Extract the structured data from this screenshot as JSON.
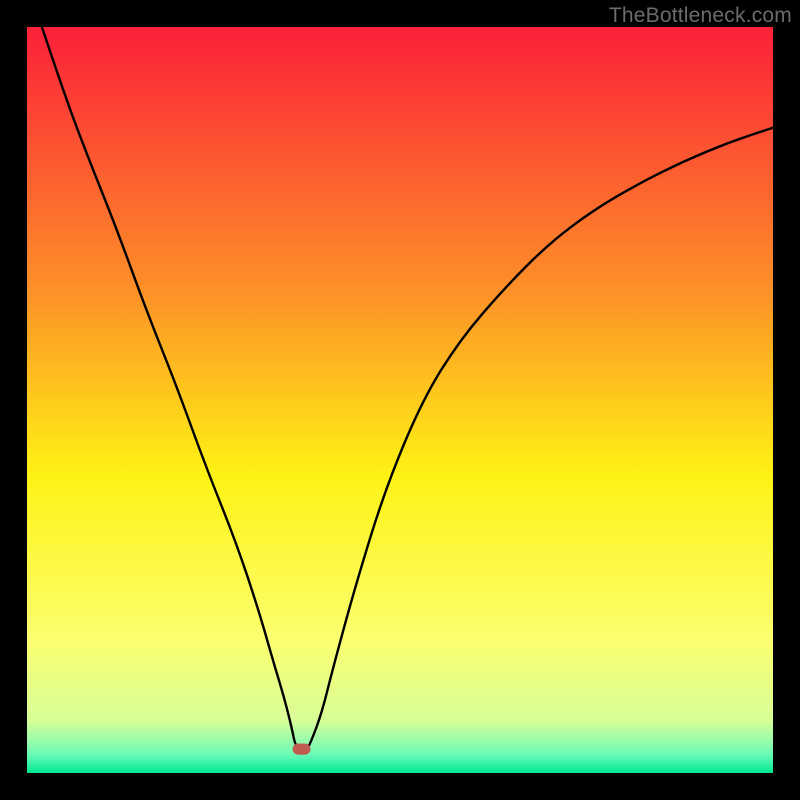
{
  "watermark": "TheBottleneck.com",
  "chart_data": {
    "type": "line",
    "title": "",
    "xlabel": "",
    "ylabel": "",
    "xlim": [
      0,
      100
    ],
    "ylim": [
      0,
      100
    ],
    "grid": false,
    "legend": false,
    "background_gradient": {
      "stops": [
        {
          "offset": 0.0,
          "color": "#fb2039"
        },
        {
          "offset": 0.35,
          "color": "#fd8f28"
        },
        {
          "offset": 0.6,
          "color": "#fef214"
        },
        {
          "offset": 0.82,
          "color": "#fcff6f"
        },
        {
          "offset": 0.93,
          "color": "#d8fe98"
        },
        {
          "offset": 0.975,
          "color": "#6bfbb7"
        },
        {
          "offset": 1.0,
          "color": "#00e992"
        }
      ]
    },
    "series": [
      {
        "name": "bottleneck-curve",
        "type": "line",
        "color": "#000000",
        "x": [
          2,
          5,
          8,
          12,
          16,
          20,
          24,
          28,
          31,
          33,
          34.5,
          35.5,
          36,
          37,
          37.5,
          38,
          39.5,
          41,
          44,
          48,
          53,
          58,
          64,
          70,
          76,
          82,
          88,
          94,
          100
        ],
        "y": [
          100,
          91,
          83,
          73,
          62,
          52,
          41,
          31,
          22,
          15,
          10,
          6,
          3.5,
          3.2,
          3.2,
          4,
          8,
          14,
          25,
          38,
          50,
          58,
          65,
          71,
          75.5,
          79,
          82,
          84.5,
          86.5
        ]
      },
      {
        "name": "minimum-marker",
        "type": "marker",
        "color": "#c15a4f",
        "shape": "rounded-rect",
        "x": 36.8,
        "y": 3.2,
        "width_pct": 2.4,
        "height_pct": 1.5
      }
    ]
  }
}
